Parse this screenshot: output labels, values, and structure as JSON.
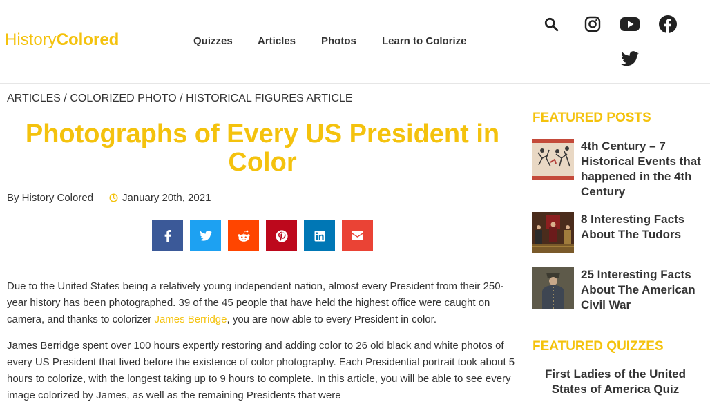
{
  "header": {
    "logo_part1": "History",
    "logo_part2": "Colored",
    "nav": [
      "Quizzes",
      "Articles",
      "Photos",
      "Learn to Colorize"
    ],
    "icons": [
      "search-icon",
      "instagram-icon",
      "youtube-icon",
      "facebook-icon",
      "twitter-icon"
    ]
  },
  "breadcrumb": {
    "items": [
      "Articles",
      "Colorized Photo",
      "Historical Figures Article"
    ],
    "separator": "/"
  },
  "article": {
    "title": "Photographs of Every US President in Color",
    "author": "By History Colored",
    "date": "January 20th, 2021",
    "share_buttons": [
      {
        "name": "facebook",
        "color": "#3b5998"
      },
      {
        "name": "twitter",
        "color": "#1da1f2"
      },
      {
        "name": "reddit",
        "color": "#ff4500"
      },
      {
        "name": "pinterest",
        "color": "#bd081c"
      },
      {
        "name": "linkedin",
        "color": "#0077b5"
      },
      {
        "name": "email",
        "color": "#ea4335"
      }
    ],
    "p1_before": "Due to the United States being a relatively young independent nation, almost every President from their 250-year history has been photographed. 39 of the 45 people that have held the highest office were caught on camera, and thanks to colorizer ",
    "p1_link": "James Berridge",
    "p1_after": ", you are now able to every President in color.",
    "p2": "James Berridge spent over 100 hours expertly restoring and adding color to 26 old black and white photos of every US President that lived before the existence of color photography. Each Presidential portrait took about 5 hours to colorize, with the longest taking up to 9 hours to complete. In this article, you will be able to see every image colorized by James, as well as the remaining Presidents that were"
  },
  "sidebar": {
    "featured_posts_heading": "FEATURED POSTS",
    "posts": [
      {
        "title": "4th Century – 7 Historical Events that happened in the 4th Century"
      },
      {
        "title": "8 Interesting Facts About The Tudors"
      },
      {
        "title": "25 Interesting Facts About The American Civil War"
      }
    ],
    "featured_quizzes_heading": "FEATURED QUIZZES",
    "quiz_title": "First Ladies of the United States of America Quiz"
  },
  "colors": {
    "accent": "#f4c20d",
    "text": "#333333"
  }
}
